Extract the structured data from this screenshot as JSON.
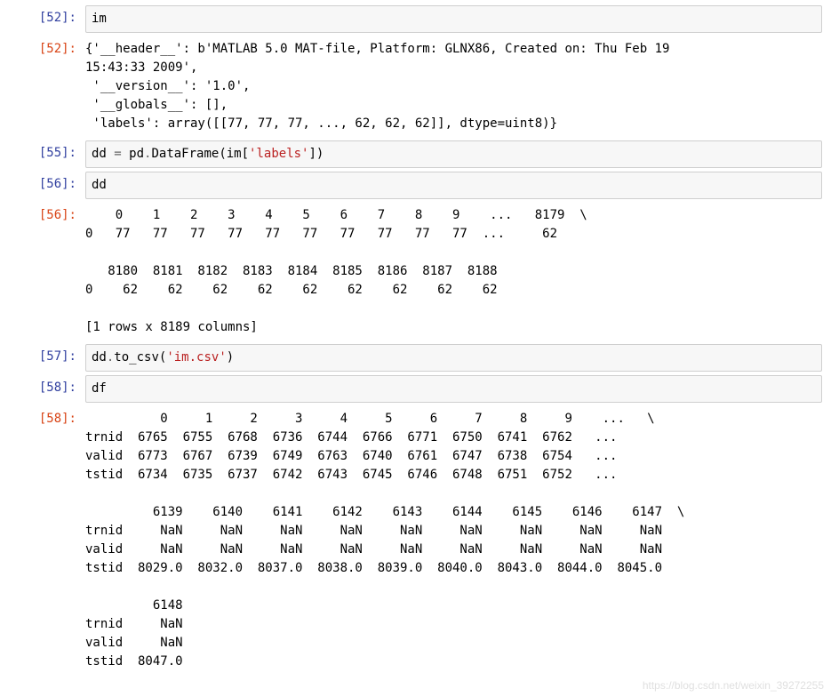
{
  "cells": [
    {
      "prompt_in": "[52]:",
      "code_plain": "im",
      "prompt_out": "[52]:",
      "output": "{'__header__': b'MATLAB 5.0 MAT-file, Platform: GLNX86, Created on: Thu Feb 19 \n15:43:33 2009',\n '__version__': '1.0',\n '__globals__': [],\n 'labels': array([[77, 77, 77, ..., 62, 62, 62]], dtype=uint8)}"
    },
    {
      "prompt_in": "[55]:",
      "code_tokens": [
        {
          "t": "dd ",
          "c": ""
        },
        {
          "t": "=",
          "c": "op"
        },
        {
          "t": " pd",
          "c": ""
        },
        {
          "t": ".",
          "c": "op"
        },
        {
          "t": "DataFrame(im[",
          "c": ""
        },
        {
          "t": "'labels'",
          "c": "str"
        },
        {
          "t": "])",
          "c": ""
        }
      ]
    },
    {
      "prompt_in": "[56]:",
      "code_plain": "dd",
      "prompt_out": "[56]:",
      "output": "    0    1    2    3    4    5    6    7    8    9    ...   8179  \\\n0   77   77   77   77   77   77   77   77   77   77  ...     62   \n\n   8180  8181  8182  8183  8184  8185  8186  8187  8188  \n0    62    62    62    62    62    62    62    62    62  \n\n[1 rows x 8189 columns]"
    },
    {
      "prompt_in": "[57]:",
      "code_tokens": [
        {
          "t": "dd",
          "c": ""
        },
        {
          "t": ".",
          "c": "op"
        },
        {
          "t": "to_csv(",
          "c": ""
        },
        {
          "t": "'im.csv'",
          "c": "str"
        },
        {
          "t": ")",
          "c": ""
        }
      ]
    },
    {
      "prompt_in": "[58]:",
      "code_plain": "df",
      "prompt_out": "[58]:",
      "output": "          0     1     2     3     4     5     6     7     8     9    ...   \\\ntrnid  6765  6755  6768  6736  6744  6766  6771  6750  6741  6762   ...    \nvalid  6773  6767  6739  6749  6763  6740  6761  6747  6738  6754   ...    \ntstid  6734  6735  6737  6742  6743  6745  6746  6748  6751  6752   ...    \n\n         6139    6140    6141    6142    6143    6144    6145    6146    6147  \\\ntrnid     NaN     NaN     NaN     NaN     NaN     NaN     NaN     NaN     NaN   \nvalid     NaN     NaN     NaN     NaN     NaN     NaN     NaN     NaN     NaN   \ntstid  8029.0  8032.0  8037.0  8038.0  8039.0  8040.0  8043.0  8044.0  8045.0   \n\n         6148  \ntrnid     NaN  \nvalid     NaN  \ntstid  8047.0  "
    }
  ],
  "watermark": "https://blog.csdn.net/weixin_39272255"
}
